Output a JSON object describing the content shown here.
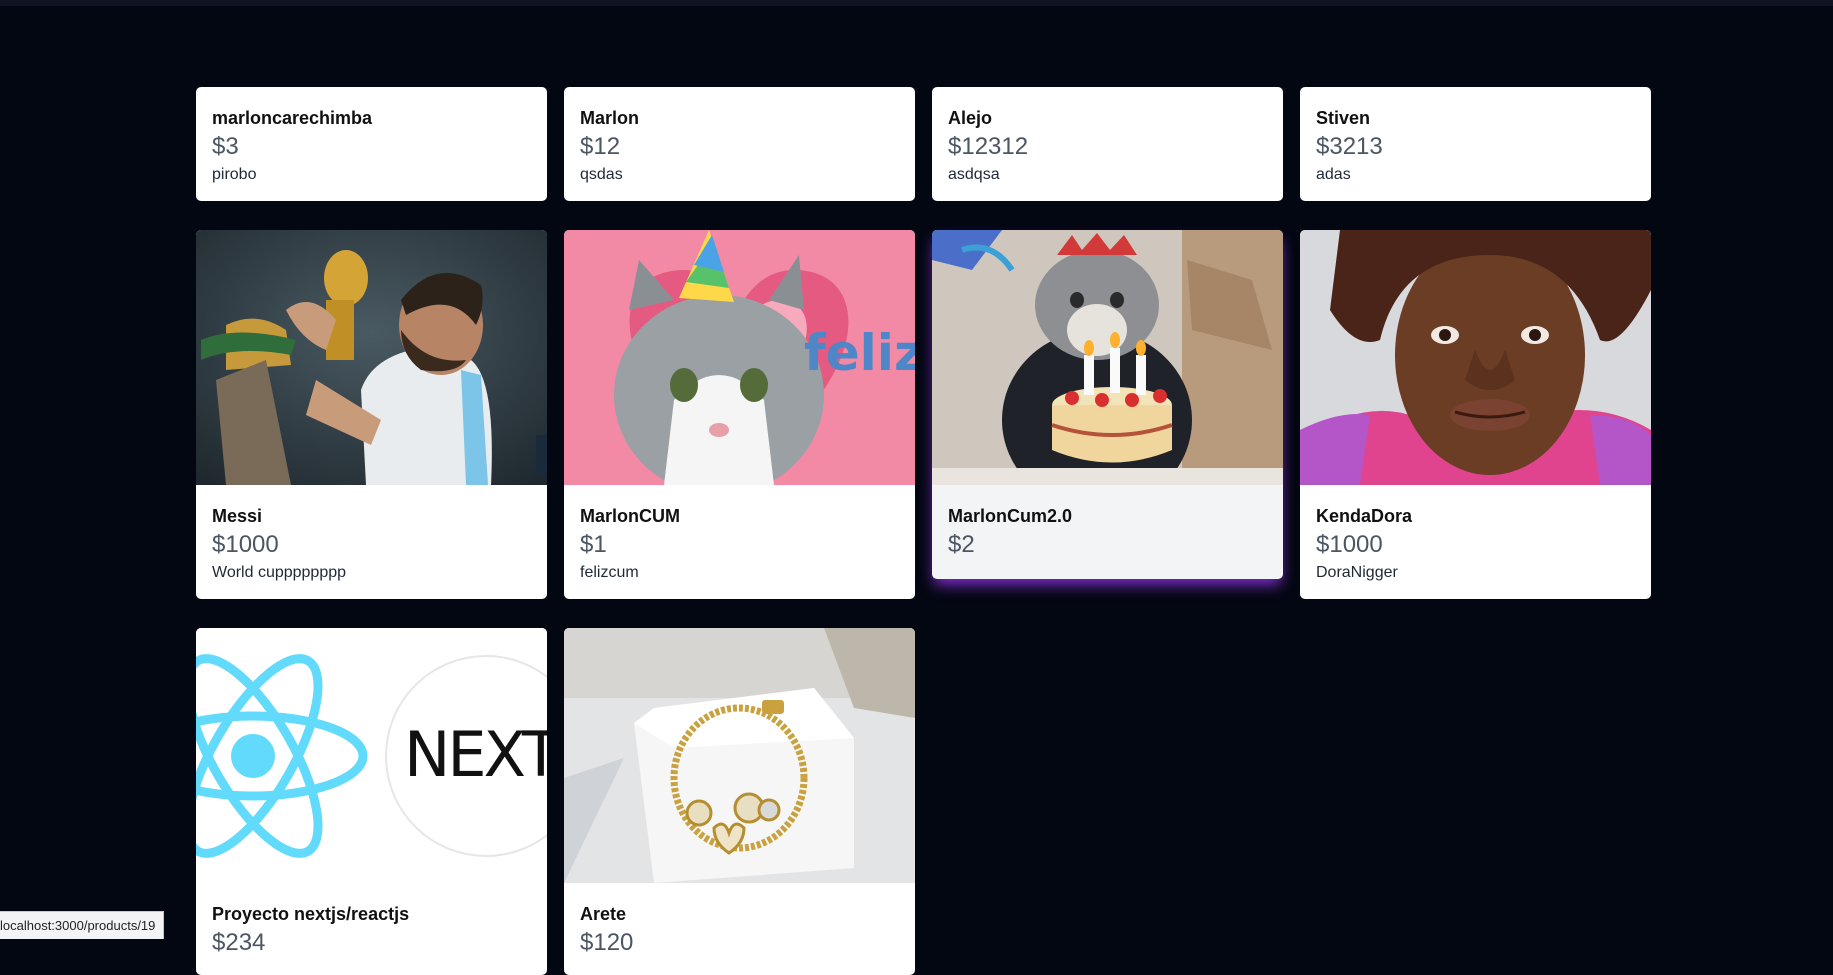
{
  "products": [
    {
      "name": "marloncarechimba",
      "price": "$3",
      "description": "pirobo"
    },
    {
      "name": "Marlon",
      "price": "$12",
      "description": "qsdas"
    },
    {
      "name": "Alejo",
      "price": "$12312",
      "description": "asdqsa"
    },
    {
      "name": "Stiven",
      "price": "$3213",
      "description": "adas"
    },
    {
      "name": "Messi",
      "price": "$1000",
      "description": "World cupppppppp",
      "image": "messi-trophy-photo"
    },
    {
      "name": "MarlonCUM",
      "price": "$1",
      "description": "felizcum",
      "image": "party-hat-cat-image",
      "image_text": "feliz cum"
    },
    {
      "name": "MarlonCum2.0",
      "price": "$2",
      "description": "",
      "image": "birthday-cake-cat-image"
    },
    {
      "name": "KendaDora",
      "price": "$1000",
      "description": "DoraNigger",
      "image": "man-bucket-hat-photo"
    },
    {
      "name": "Proyecto nextjs/reactjs",
      "price": "$234",
      "description": "",
      "image": "react-next-logos-image",
      "image_text": "NEXT."
    },
    {
      "name": "Arete",
      "price": "$120",
      "description": "",
      "image": "gold-charm-bracelet-photo"
    }
  ],
  "status_bar": {
    "url": "localhost:3000/products/19"
  },
  "colors": {
    "background": "#030712",
    "card": "#ffffff",
    "card_hover": "#f3f4f6",
    "hover_glow": "#9333ea",
    "price_text": "#4b5563"
  }
}
